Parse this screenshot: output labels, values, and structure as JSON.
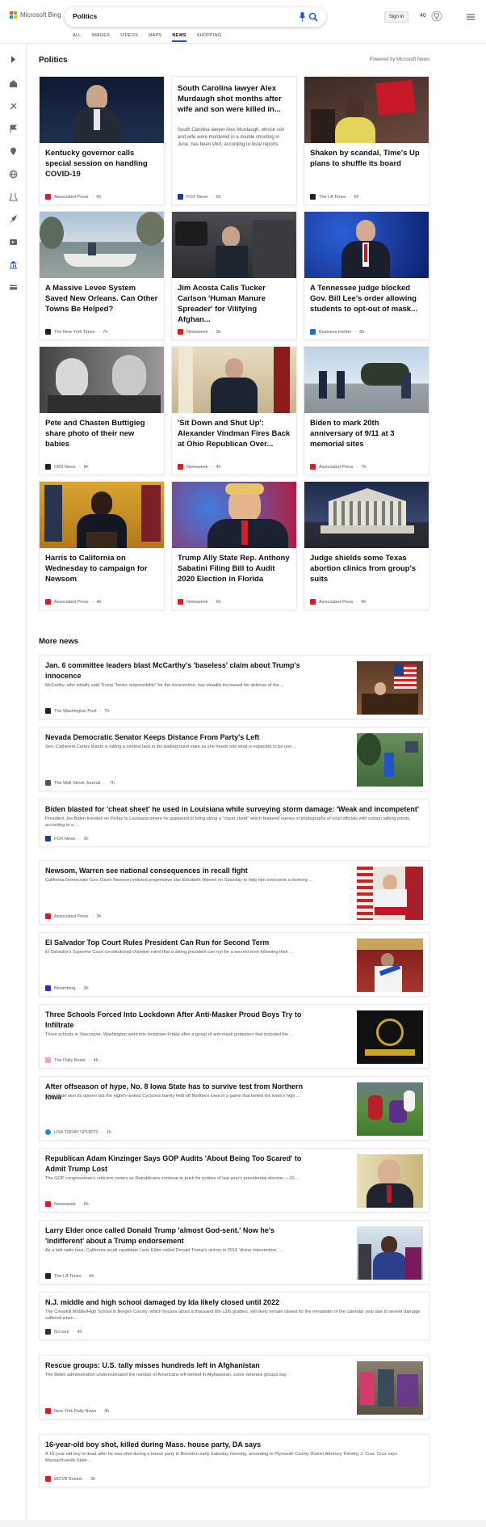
{
  "header": {
    "brand": "Microsoft Bing",
    "query": "Politics",
    "sign_in": "Sign in",
    "points": "40"
  },
  "tabs": [
    "ALL",
    "IMAGES",
    "VIDEOS",
    "MAPS",
    "NEWS",
    "SHOPPING"
  ],
  "active_tab": "NEWS",
  "section": {
    "title": "Politics",
    "powered_by": "Powered by Microsoft News"
  },
  "cards": [
    {
      "title": "Kentucky governor calls special session on handling COVID-19",
      "source": "Associated Press",
      "time": "5h",
      "icon_color": "#d21f2b",
      "image": "governor-speaking-photo"
    },
    {
      "title": "South Carolina lawyer Alex Murdaugh shot months after wife and son were killed in...",
      "snippet": "South Carolina lawyer Alex Murdaugh, whose son and wife were murdered in a double shooting in June, has been shot, according to local reports.",
      "source": "FOX News",
      "time": "5h",
      "icon_color": "#1a3d8f",
      "image": ""
    },
    {
      "title": "Shaken by scandal, Time's Up plans to shuffle its board",
      "source": "The LA Times",
      "time": "6h",
      "icon_color": "#222",
      "image": "protest-signs-photo"
    },
    {
      "title": "A Massive Levee System Saved New Orleans. Can Other Towns Be Helped?",
      "source": "The New York Times",
      "time": "7h",
      "icon_color": "#222",
      "image": "flooded-boat-photo"
    },
    {
      "title": "Jim Acosta Calls Tucker Carlson 'Human Manure Spreader' for Vilifying Afghan...",
      "source": "Newsweek",
      "time": "3h",
      "icon_color": "#e01b22",
      "image": "press-cameras-photo"
    },
    {
      "title": "A Tennessee judge blocked Gov. Bill Lee's order allowing students to opt-out of mask...",
      "source": "Business Insider",
      "time": "6h",
      "icon_color": "#2469d6",
      "image": "governor-blue-backdrop-photo"
    },
    {
      "title": "Pete and Chasten Buttigieg share photo of their new babies",
      "source": "CBS News",
      "time": "9h",
      "icon_color": "#222",
      "image": "couple-bw-photo"
    },
    {
      "title": "'Sit Down and Shut Up': Alexander Vindman Fires Back at Ohio Republican Over...",
      "source": "Newsweek",
      "time": "4h",
      "icon_color": "#e01b22",
      "image": "officer-uniform-photo"
    },
    {
      "title": "Biden to mark 20th anniversary of 9/11 at 3 memorial sites",
      "source": "Associated Press",
      "time": "7h",
      "icon_color": "#d21f2b",
      "image": "helicopter-photo"
    },
    {
      "title": "Harris to California on Wednesday to campaign for Newsom",
      "source": "Associated Press",
      "time": "4h",
      "icon_color": "#d21f2b",
      "image": "vp-podium-photo"
    },
    {
      "title": "Trump Ally State Rep. Anthony Sabatini Filing Bill to Audit 2020 Election in Florida",
      "source": "Newsweek",
      "time": "5h",
      "icon_color": "#e01b22",
      "image": "trump-portrait-photo"
    },
    {
      "title": "Judge shields some Texas abortion clinics from group's suits",
      "source": "Associated Press",
      "time": "9h",
      "icon_color": "#d21f2b",
      "image": "supreme-court-photo"
    }
  ],
  "more_news_title": "More news",
  "more_news": [
    {
      "title": "Jan. 6 committee leaders blast McCarthy's 'baseless' claim about Trump's innocence",
      "snippet": "McCarthy, who initially said Trump \"bears responsibility\" for the insurrection, has steadily increased his defense of the ...",
      "source": "The Washington Post",
      "time": "7h",
      "icon_color": "#222"
    },
    {
      "title": "Nevada Democratic Senator Keeps Distance From Party's Left",
      "snippet": "Sen. Catherine Cortez Masto is taking a centrist tack in the battleground state as she heads into what is expected to be one ...",
      "source": "The Wall Street Journal.",
      "time": "7h",
      "icon_color": "#555"
    },
    {
      "title": "Biden blasted for 'cheat sheet' he used in Louisiana while surveying storm damage: 'Weak and incompetent'",
      "snippet": "President Joe Biden traveled on Friday to Louisiana where he appeared to bring along a \"cheat sheet\" which featured names of photographs of local officials with certain talking points, according to a ...",
      "source": "FOX News",
      "time": "3h",
      "icon_color": "#1a3d8f"
    },
    {
      "title": "Newsom, Warren see national consequences in recall fight",
      "snippet": "California Democratic Gov. Gavin Newsom enlisted progressive star Elizabeth Warren on Saturday to help him overcome a looming ...",
      "source": "Associated Press",
      "time": "3h",
      "icon_color": "#d21f2b"
    },
    {
      "title": "El Salvador Top Court Rules President Can Run for Second Term",
      "snippet": "El Salvador's Supreme Court constitutional chamber ruled that a sitting president can run for a second term following their ...",
      "source": "Bloomberg",
      "time": "3h",
      "icon_color": "#4a1ed6"
    },
    {
      "title": "Three Schools Forced Into Lockdown After Anti-Masker Proud Boys Try to Infiltrate",
      "snippet": "Three schools in Vancouver, Washington went into lockdown Friday after a group of anti-mask protesters that included the ...",
      "source": "The Daily Beast",
      "time": "4h",
      "icon_color": "#f0a8a8"
    },
    {
      "title": "After offseason of hype, No. 8 Iowa State has to survive test from Northern Iowa",
      "snippet": "Iowa State won its opener but the eighth-ranked Cyclones barely held off Northern Iowa in a game that belied the team's high ...",
      "source": "USA TODAY SPORTS",
      "time": "1h",
      "icon_color": "#1e88e5"
    },
    {
      "title": "Republican Adam Kinzinger Says GOP Audits 'About Being Too Scared' to Admit Trump Lost",
      "snippet": "The GOP congressman's criticism comes as Republicans continue to push for probes of last year's presidential election —10 ...",
      "source": "Newsweek",
      "time": "5h",
      "icon_color": "#e01b22"
    },
    {
      "title": "Larry Elder once called Donald Trump 'almost God-sent.' Now he's 'indifferent' about a Trump endorsement",
      "snippet": "As a talk radio host, California recall candidate Larry Elder called Donald Trump's victory in 2016 'divine intervention.' ...",
      "source": "The LA Times",
      "time": "6h",
      "icon_color": "#222"
    },
    {
      "title": "N.J. middle and high school damaged by Ida likely closed until 2022",
      "snippet": "The Cresskill Middle/High School in Bergen County, which houses about a thousand 6th-12th graders, will likely remain closed for the remainder of the calendar year due to severe damage suffered when ...",
      "source": "NJ.com",
      "time": "4h",
      "icon_color": "#333"
    },
    {
      "title": "Rescue groups: U.S. tally misses hundreds left in Afghanistan",
      "snippet": "The Biden administration underestimated the number of Americans left behind in Afghanistan, some veterans groups say.",
      "source": "New York Daily News",
      "time": "3h",
      "icon_color": "#e01b22"
    },
    {
      "title": "16-year-old boy shot, killed during Mass. house party, DA says",
      "snippet": "A 16-year-old boy is dead after he was shot during a house party in Brockton early Saturday morning, according to Plymouth County District Attorney Timothy J. Cruz. Cruz says Massachusetts State ...",
      "source": "WCVB Boston",
      "time": "3h",
      "icon_color": "#e01b22"
    }
  ],
  "colors": {
    "accent": "#174ae4",
    "ms_red": "#f25022",
    "ms_green": "#7fba00",
    "ms_blue": "#00a4ef",
    "ms_yellow": "#ffb900"
  }
}
